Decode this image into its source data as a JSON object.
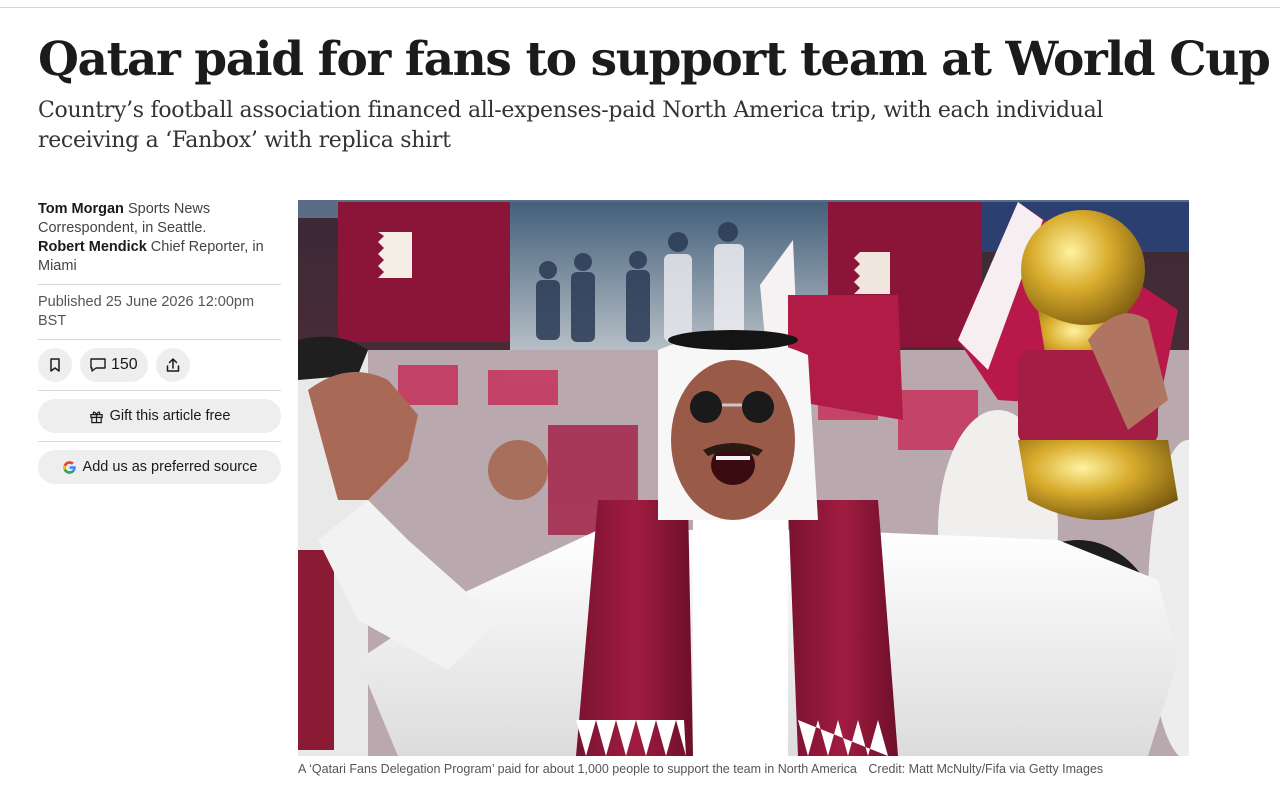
{
  "article": {
    "headline": "Qatar paid for fans to support team at World Cup",
    "standfirst": "Country’s football association financed all-expenses-paid North America trip, with each individual receiving a ‘Fanbox’ with replica shirt"
  },
  "authors": [
    {
      "name": "Tom Morgan",
      "role": "Sports News Correspondent, in Seattle."
    },
    {
      "name": "Robert Mendick",
      "role": "Chief Reporter, in Miami"
    }
  ],
  "published": "Published 25 June 2026 12:00pm BST",
  "actions": {
    "bookmark_icon": "bookmark-icon",
    "comment_icon": "comment-icon",
    "comment_count": "150",
    "share_icon": "share-icon"
  },
  "buttons": {
    "gift_label": "Gift this article free",
    "gift_icon": "gift-icon",
    "preferred_source_label": "Add us as preferred source",
    "preferred_source_icon": "google-g-icon"
  },
  "image": {
    "caption": "A ‘Qatari Fans Delegation Program’ paid for about 1,000 people to support the team in North America",
    "credit": "Credit: Matt McNulty/Fifa via Getty Images"
  },
  "colors": {
    "qatar_maroon": "#8a1538",
    "pill_background": "#eeeeee",
    "google_blue": "#4285F4",
    "google_red": "#EA4335",
    "google_yellow": "#FBBC05",
    "google_green": "#34A853"
  }
}
